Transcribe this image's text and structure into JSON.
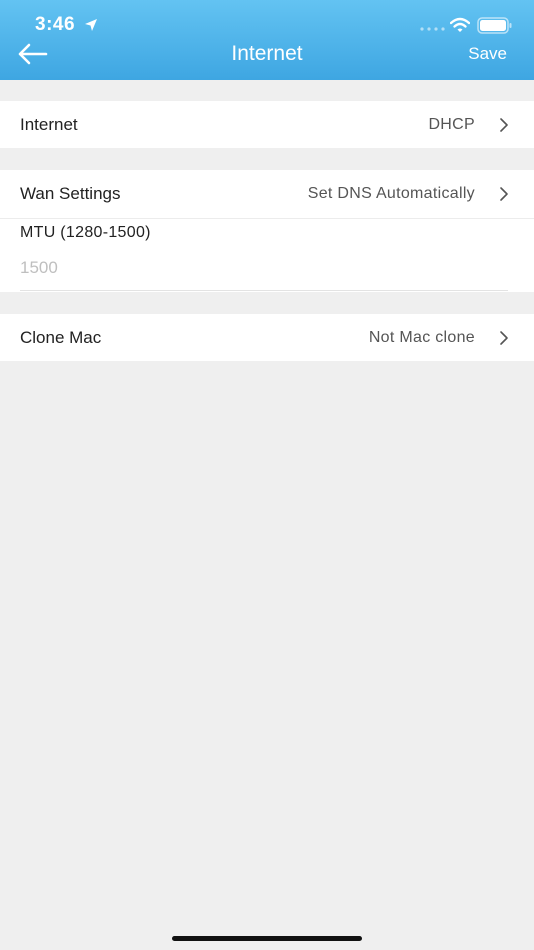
{
  "status_bar": {
    "time": "3:46"
  },
  "nav": {
    "title": "Internet",
    "save_label": "Save"
  },
  "rows": {
    "internet": {
      "label": "Internet",
      "value": "DHCP"
    },
    "wan": {
      "label": "Wan Settings",
      "value": "Set DNS Automatically"
    },
    "clone_mac": {
      "label": "Clone Mac",
      "value": "Not Mac clone"
    }
  },
  "mtu": {
    "label": "MTU  (1280-1500)",
    "placeholder": "1500"
  },
  "colors": {
    "header_top": "#63c3f2",
    "header_bottom": "#3ea6e2",
    "background": "#efefef"
  }
}
